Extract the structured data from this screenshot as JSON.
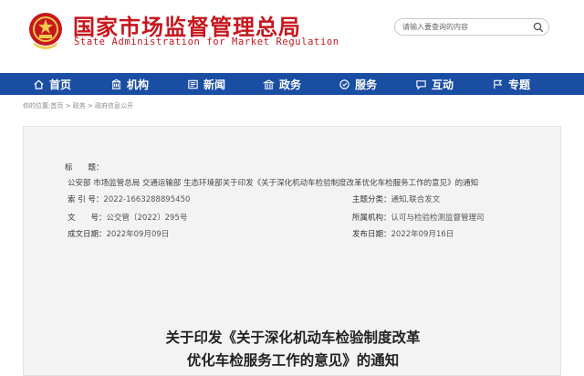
{
  "header": {
    "title_cn": "国家市场监督管理总局",
    "title_en": "State Administration for Market Regulation",
    "search": {
      "placeholder": "请输入要查询的内容"
    }
  },
  "nav": {
    "items": [
      {
        "label": "首页",
        "icon": "home-icon"
      },
      {
        "label": "机构",
        "icon": "building-icon"
      },
      {
        "label": "新闻",
        "icon": "newspaper-icon"
      },
      {
        "label": "政务",
        "icon": "government-icon"
      },
      {
        "label": "服务",
        "icon": "service-icon"
      },
      {
        "label": "互动",
        "icon": "chat-icon"
      },
      {
        "label": "专题",
        "icon": "flag-icon"
      }
    ]
  },
  "breadcrumb": "你的位置:首页 > 政务 > 政府信息公开",
  "meta": {
    "title_label": "标　　题：",
    "title_value": "公安部 市场监管总局 交通运输部 生态环境部关于印发《关于深化机动车检验制度改革优化车检服务工作的意见》的通知",
    "index_label": "索 引 号：",
    "index_value": "2022-1663288895450",
    "category_label": "主题分类：",
    "category_value": "通知,联合发文",
    "docno_label": "文　　号：",
    "docno_value": "公交管〔2022〕295号",
    "org_label": "所属机构：",
    "org_value": "认可与检验检测监督管理司",
    "created_label": "成文日期：",
    "created_value": "2022年09月09日",
    "published_label": "发布日期：",
    "published_value": "2022年09月16日"
  },
  "document": {
    "title_line1": "关于印发《关于深化机动车检验制度改革",
    "title_line2": "优化车检服务工作的意见》的通知"
  },
  "colors": {
    "brand_red": "#c8161d",
    "nav_blue": "#1a4ea3"
  }
}
